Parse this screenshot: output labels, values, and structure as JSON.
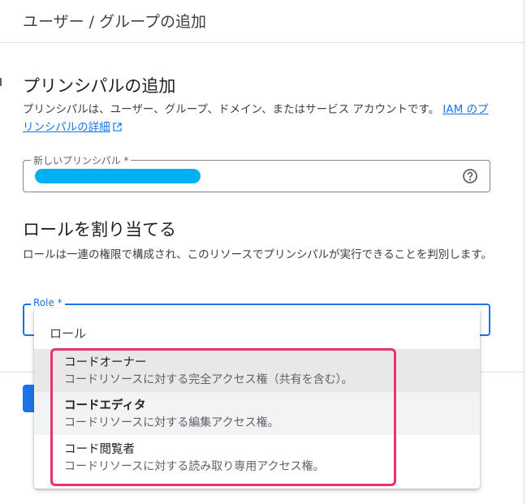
{
  "header": {
    "title": "ユーザー / グループの追加"
  },
  "principals": {
    "title": "プリンシパルの追加",
    "description": "プリンシパルは、ユーザー、グループ、ドメイン、またはサービス アカウントです。",
    "link_text": "IAM のプリンシパルの詳細",
    "field_label": "新しいプリンシパル *"
  },
  "roles": {
    "title": "ロールを割り当てる",
    "description": "ロールは一連の権限で構成され、このリソースでプリンシパルが実行できることを判別します。",
    "field_label": "Role *"
  },
  "dropdown": {
    "header": "ロール",
    "items": [
      {
        "name": "コードオーナー",
        "description": "コードリソースに対する完全アクセス権（共有を含む）。"
      },
      {
        "name": "コードエディタ",
        "description": "コードリソースに対する編集アクセス権。"
      },
      {
        "name": "コード閲覧者",
        "description": "コードリソースに対する読み取り専用アクセス権。"
      }
    ]
  },
  "colors": {
    "accent": "#1a73e8",
    "highlight": "#e8336b",
    "redaction": "#00b0f0"
  }
}
